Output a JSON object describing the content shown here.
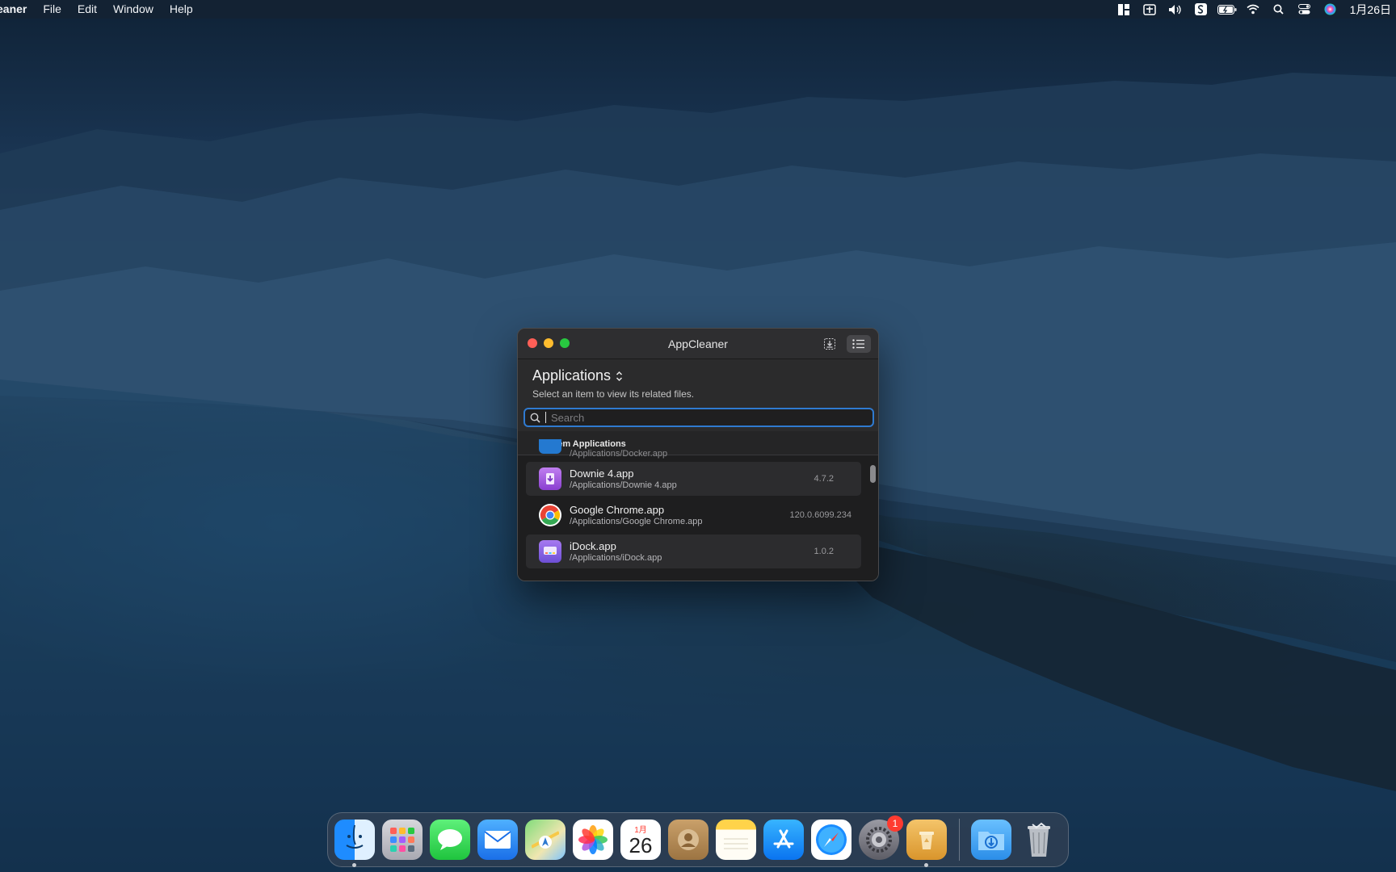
{
  "menubar": {
    "app_name": "eaner",
    "items": [
      "File",
      "Edit",
      "Window",
      "Help"
    ],
    "clock": "1月26日"
  },
  "window": {
    "title": "AppCleaner",
    "selector_label": "Applications",
    "subtitle": "Select an item to view its related files.",
    "search_placeholder": "Search",
    "section_header": "System Applications",
    "partial_path": "/Applications/Docker.app",
    "apps": [
      {
        "name": "Downie 4.app",
        "path": "/Applications/Downie 4.app",
        "version": "4.7.2",
        "icon": "downie-icon",
        "color": "#a25cd6"
      },
      {
        "name": "Google Chrome.app",
        "path": "/Applications/Google Chrome.app",
        "version": "120.0.6099.234",
        "icon": "chrome-icon",
        "color": "#ffffff"
      },
      {
        "name": "iDock.app",
        "path": "/Applications/iDock.app",
        "version": "1.0.2",
        "icon": "idock-icon",
        "color": "#9b6be0"
      }
    ]
  },
  "dock": {
    "calendar_month": "1月",
    "calendar_day": "26",
    "settings_badge": "1"
  }
}
